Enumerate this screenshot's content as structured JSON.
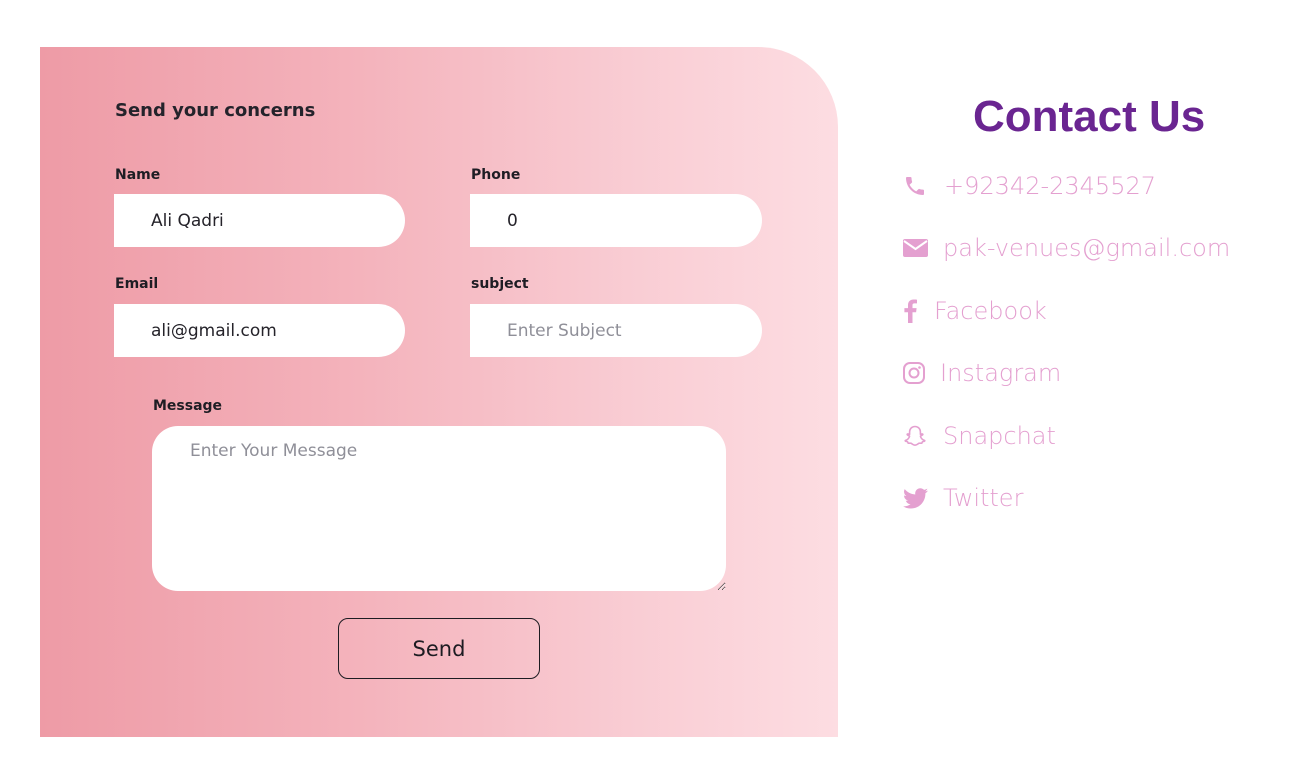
{
  "form": {
    "title": "Send your concerns",
    "name": {
      "label": "Name",
      "value": "Ali Qadri"
    },
    "phone": {
      "label": "Phone",
      "value": "0"
    },
    "email": {
      "label": "Email",
      "value": "ali@gmail.com"
    },
    "subject": {
      "label": "subject",
      "placeholder": "Enter Subject"
    },
    "message": {
      "label": "Message",
      "placeholder": "Enter Your Message"
    },
    "send_label": "Send"
  },
  "contact": {
    "title": "Contact Us",
    "items": [
      {
        "icon": "phone-icon",
        "text": "+92342-2345527"
      },
      {
        "icon": "envelope-icon",
        "text": "pak-venues@gmail.com"
      },
      {
        "icon": "facebook-icon",
        "text": "Facebook"
      },
      {
        "icon": "instagram-icon",
        "text": "Instagram"
      },
      {
        "icon": "snapchat-icon",
        "text": "Snapchat"
      },
      {
        "icon": "twitter-icon",
        "text": "Twitter"
      }
    ]
  },
  "colors": {
    "gradient_start": "#ee9ba6",
    "gradient_end": "#fddde2",
    "contact_title": "#6a2591",
    "contact_items": "#e4a0d0"
  }
}
